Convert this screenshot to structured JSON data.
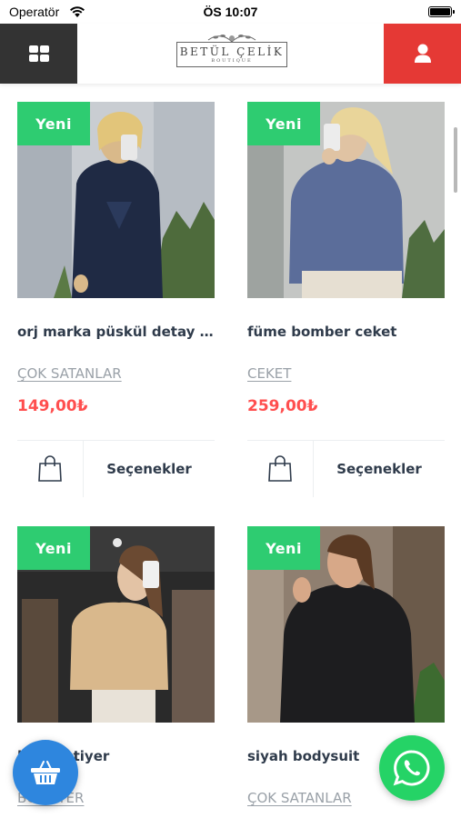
{
  "status_bar": {
    "carrier": "Operatör",
    "time": "ÖS 10:07"
  },
  "header": {
    "logo_name": "BETÜL ÇELİK",
    "logo_sub": "BOUTIQUE",
    "menu_icon": "grid-icon",
    "account_icon": "user-icon"
  },
  "colors": {
    "menu_bg": "#333333",
    "account_bg": "#e53935",
    "badge": "#2ecc71",
    "price": "#ff4f4f",
    "cart_fab": "#2e86de",
    "whatsapp_fab": "#25d366"
  },
  "products": [
    {
      "badge": "Yeni",
      "title": "orj marka püskül detay elbise",
      "category": "ÇOK SATANLAR",
      "price": "149,00₺",
      "options_label": "Seçenekler"
    },
    {
      "badge": "Yeni",
      "title": "füme bomber ceket",
      "category": "CEKET",
      "price": "259,00₺",
      "options_label": "Seçenekler"
    },
    {
      "badge": "Yeni",
      "title": "bej büstiyer",
      "category": "BÜSTİYER",
      "price": "",
      "options_label": ""
    },
    {
      "badge": "Yeni",
      "title": "siyah bodysuit",
      "category": "ÇOK SATANLAR",
      "price": "",
      "options_label": ""
    }
  ],
  "floating": {
    "cart_icon": "basket-icon",
    "whatsapp_icon": "whatsapp-icon"
  }
}
